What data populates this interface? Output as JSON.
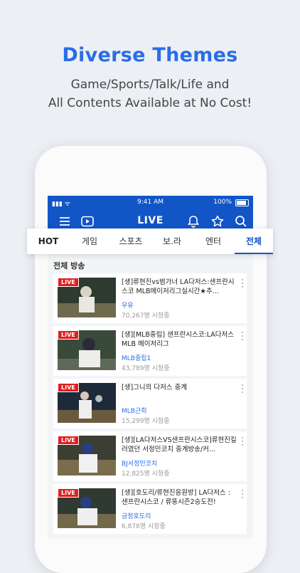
{
  "promo": {
    "headline": "Diverse Themes",
    "line1": "Game/Sports/Talk/Life and",
    "line2": "All Contents Available at No Cost!"
  },
  "status": {
    "time": "9:41 AM",
    "battery": "100%"
  },
  "topbar": {
    "title": "LIVE",
    "icons": [
      "menu-icon",
      "play-icon",
      "bell-icon",
      "star-icon",
      "search-icon"
    ]
  },
  "tabs": [
    {
      "label": "HOT"
    },
    {
      "label": "게임"
    },
    {
      "label": "스포츠"
    },
    {
      "label": "보.라"
    },
    {
      "label": "엔터"
    },
    {
      "label": "전체"
    }
  ],
  "section": {
    "title": "전체 방송"
  },
  "badge": "LIVE",
  "broadcasts": [
    {
      "title": "[생]류현진vs범가너 LA다저스:샌프란시스코 MLB메이저리그실시간★추...",
      "user": "우유",
      "viewers": "70,267명 시청중"
    },
    {
      "title": "[생][MLB중립] 샌프란시스코:LA다저스 MLB 메이저리그",
      "user": "MLB중립1",
      "viewers": "43,789명 시청중"
    },
    {
      "title": "[생]그니의 다저스 중계",
      "user": "MLB근희",
      "viewers": "15,299명 시청중"
    },
    {
      "title": "[생][LA다저스VS샌프란시스코]류현진킬러였던 서정민코치 중계방송/커...",
      "user": "BJ서정민코치",
      "viewers": "12,825명 시청중"
    },
    {
      "title": "[생][호도리/류현진응원방] LA다저스 : 샌프란시스코 / 류뚱시즌2승도전!",
      "user": "긍정호도리",
      "viewers": "6,878명 시청중"
    }
  ],
  "colors": {
    "accent": "#1255c7",
    "live": "#e02020",
    "headline": "#2a6de6"
  }
}
